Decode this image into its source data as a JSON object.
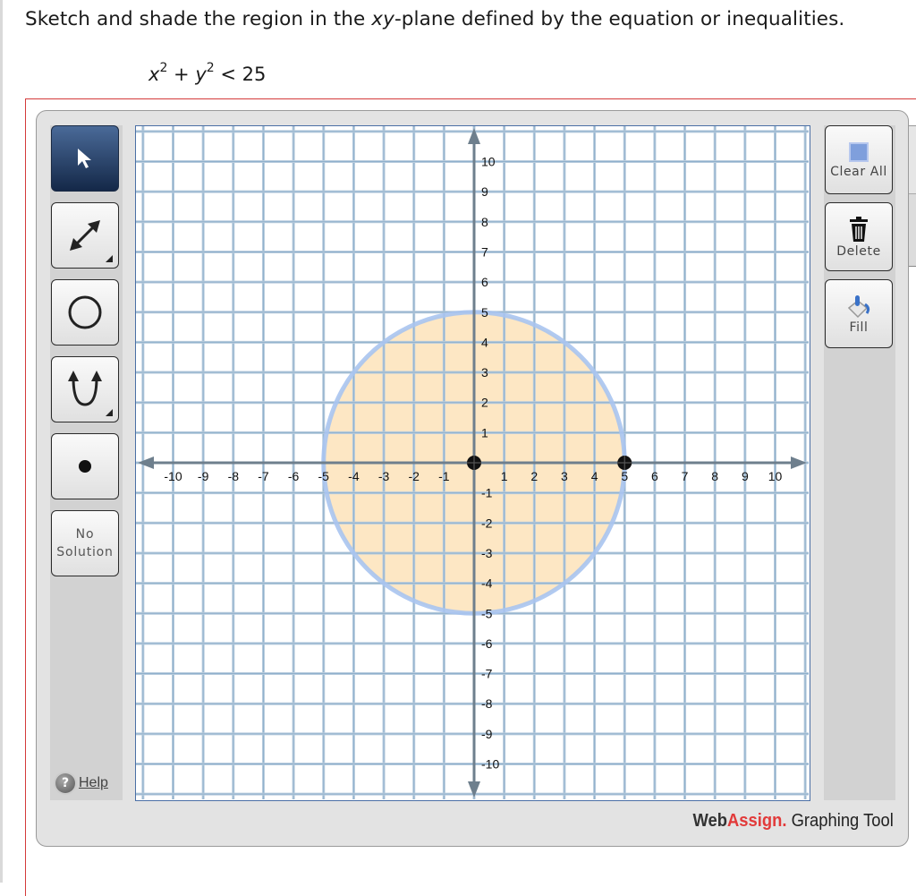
{
  "question": {
    "prefix": "Sketch and shade the region in the ",
    "var": "xy",
    "suffix": "-plane defined by the equation or inequalities."
  },
  "equation": {
    "x": "x",
    "exp1": "2",
    "plus": " + ",
    "y": "y",
    "exp2": "2",
    "rest": " < 25"
  },
  "left_toolbar": {
    "tools": [
      {
        "name": "select",
        "icon": "arrow-pointer-icon",
        "active": true
      },
      {
        "name": "line",
        "icon": "double-arrow-line-icon",
        "has_submenu": true
      },
      {
        "name": "circle",
        "icon": "circle-icon"
      },
      {
        "name": "parabola",
        "icon": "parabola-icon",
        "has_submenu": true
      },
      {
        "name": "point",
        "icon": "point-icon"
      }
    ],
    "no_solution_line1": "No",
    "no_solution_line2": "Solution",
    "help_label": "Help"
  },
  "right_toolbar": {
    "clear_all": "Clear All",
    "delete": "Delete",
    "fill": "Fill"
  },
  "branding": {
    "web": "Web",
    "assign": "Assign.",
    "tool": " Graphing Tool"
  },
  "chart_data": {
    "type": "scatter",
    "title": "",
    "xlabel": "",
    "ylabel": "",
    "xlim": [
      -11,
      11
    ],
    "ylim": [
      -11,
      11
    ],
    "grid": true,
    "x_ticks": [
      -10,
      -9,
      -8,
      -7,
      -6,
      -5,
      -4,
      -3,
      -2,
      -1,
      1,
      2,
      3,
      4,
      5,
      6,
      7,
      8,
      9,
      10
    ],
    "y_ticks": [
      -10,
      -9,
      -8,
      -7,
      -6,
      -5,
      -4,
      -3,
      -2,
      -1,
      1,
      2,
      3,
      4,
      5,
      6,
      7,
      8,
      9,
      10
    ],
    "circle": {
      "center": [
        0,
        0
      ],
      "radius": 5,
      "boundary": "dashed-excluded",
      "fill": "inside",
      "stroke_color": "#a9c4f0",
      "fill_color": "#fde7c4"
    },
    "points": [
      {
        "x": 0,
        "y": 0,
        "label": "center"
      },
      {
        "x": 5,
        "y": 0,
        "label": "radius-point"
      }
    ]
  }
}
